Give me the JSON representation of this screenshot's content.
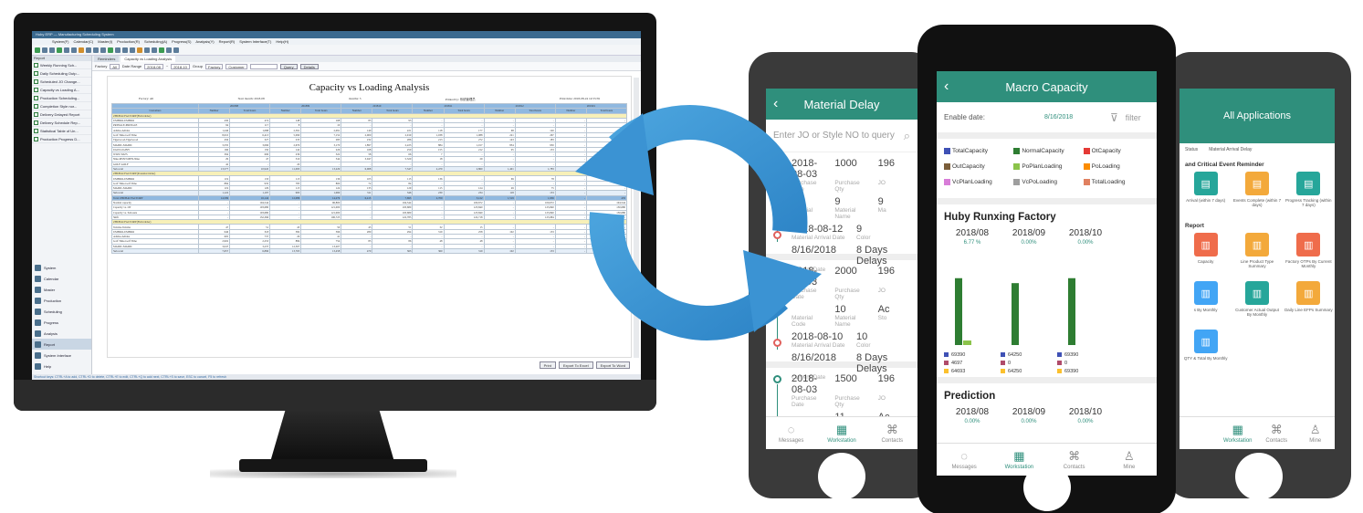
{
  "desktop": {
    "title_bar": "Huby ERP — Manufacturing Scheduling System",
    "menu": [
      "System(F)",
      "Calendar(C)",
      "Master(I)",
      "Production(R)",
      "Scheduling(A)",
      "Progress(S)",
      "Analysis(Y)",
      "Report(R)",
      "System Interface(T)",
      "Help(H)"
    ],
    "sidebar_header": "Report",
    "sidebar_reports": [
      "Weekly Running Sch...",
      "Daily Scheduling Outp...",
      "Scheduled JO Change...",
      "Capacity vs Loading A...",
      "Production Scheduling...",
      "Completion Style nor...",
      "Delivery Delayed Report",
      "Delivery Schedule Rep...",
      "Statistical Table of Un...",
      "Production Progress D..."
    ],
    "nav": [
      "System",
      "Calendar",
      "Master",
      "Production",
      "Scheduling",
      "Progress",
      "Analysis",
      "Report",
      "System Interface",
      "Help"
    ],
    "tabs": [
      "Reminders",
      "Capacity vs Loading Analysis"
    ],
    "filters": {
      "factory_label": "Factory",
      "factory_value": "All",
      "date_range_label": "Date Range",
      "date_from": "2018-08",
      "date_to": "2018-10",
      "group_label": "Group",
      "group_value": "Factory",
      "group2_value": "Customer",
      "query_btn": "Query",
      "details_btn": "Details"
    },
    "report": {
      "title": "Capacity vs Loading Analysis",
      "meta_factory": "Factory: All",
      "meta_start": "Start month: 2018-08",
      "meta_months": "months: 3",
      "meta_printed": "Printed by: 系统管理员",
      "meta_print_time": "Print time: 2018-08-24 14:55:59",
      "months": [
        "201808",
        "201809",
        "201810",
        "201811",
        "201812",
        "201901"
      ],
      "sub_headers": [
        "Number",
        "Total hours"
      ],
      "customers_label": "Customers",
      "rows": [
        {
          "type": "sect",
          "cells": [
            "ZHUHAI FACTORY(Firm Order)"
          ]
        },
        {
          "type": "row",
          "cells": [
            "UMBRO-UMBRO",
            "430",
            "474",
            "148",
            "168",
            "85",
            "93",
            "-",
            "-",
            "-",
            "-",
            "-",
            "-"
          ]
        },
        {
          "type": "row",
          "cells": [
            "PRINGLE-PRINGLE",
            "94",
            "117",
            "8",
            "10",
            "-",
            "-",
            "-",
            "-",
            "-",
            "-",
            "-",
            "-"
          ]
        },
        {
          "type": "row",
          "cells": [
            "Adidas-Adidas",
            "1,246",
            "1,088",
            "2,391",
            "2,091",
            "140",
            "221",
            "118",
            "177",
            "68",
            "120",
            "-",
            "-"
          ]
        },
        {
          "type": "row",
          "cells": [
            "Golf Time-Golf Time",
            "8,010",
            "6,413",
            "5,090",
            "7,152",
            "2,000",
            "2,919",
            "1,038",
            "1,088",
            "221",
            "267",
            "-",
            "-"
          ]
        },
        {
          "type": "row",
          "cells": [
            "Tigerwood-Tigerwood",
            "456",
            "327",
            "235",
            "283",
            "232",
            "286",
            "213",
            "272",
            "143",
            "183",
            "-",
            "-"
          ]
        },
        {
          "type": "row",
          "cells": [
            "MADIC-MADIC",
            "3,335",
            "3,066",
            "2,679",
            "3,170",
            "1,897",
            "2,223",
            "884",
            "1,017",
            "834",
            "950",
            "-",
            "-"
          ]
        },
        {
          "type": "row",
          "cells": [
            "UGIN-UGINY",
            "166",
            "150",
            "142",
            "226",
            "168",
            "250",
            "155",
            "212",
            "95",
            "133",
            "-",
            "-"
          ]
        },
        {
          "type": "row",
          "cells": [
            "WIZS-WIZS",
            "394",
            "606",
            "236",
            "322",
            "58",
            "66",
            "7",
            "-",
            "-",
            "-",
            "-",
            "-"
          ]
        },
        {
          "type": "row",
          "cells": [
            "Nike.MSNT.MEN-Nike",
            "29",
            "47",
            "310",
            "544",
            "3,047",
            "5,320",
            "18",
            "29",
            "-",
            "-",
            "-",
            "-"
          ]
        },
        {
          "type": "row",
          "cells": [
            "GOLF-GOLF",
            "42",
            "-",
            "20",
            "-",
            "-",
            "-",
            "-",
            "-",
            "-",
            "-",
            "-",
            "-"
          ]
        },
        {
          "type": "sub",
          "cells": [
            "Sub-total",
            "13,577",
            "10,945",
            "11,093",
            "13,229",
            "6,068",
            "7,347",
            "2,479",
            "2,860",
            "1,401",
            "1,783",
            "396",
            "435"
          ]
        },
        {
          "type": "sect",
          "cells": [
            "ZHUHAI FACTORY(Potential Order)"
          ]
        },
        {
          "type": "row",
          "cells": [
            "UMBRO-UMBRO",
            "119",
            "133",
            "113",
            "136",
            "105",
            "115",
            "136",
            "-",
            "69",
            "78",
            "-",
            "-"
          ]
        },
        {
          "type": "row",
          "cells": [
            "Golf Time-Golf Time",
            "884",
            "935",
            "785",
            "800",
            "72",
            "84",
            "-",
            "-",
            "-",
            "-",
            "-",
            "-"
          ]
        },
        {
          "type": "row",
          "cells": [
            "MADIC-MADIC",
            "119",
            "129",
            "115",
            "124",
            "135",
            "129",
            "115",
            "124",
            "49",
            "75",
            "-",
            "-"
          ]
        },
        {
          "type": "sub",
          "cells": [
            "Sub-total",
            "1,122",
            "1,197",
            "993",
            "1,060",
            "311",
            "346",
            "230",
            "234",
            "118",
            "153",
            "-",
            "-"
          ]
        },
        {
          "type": "total",
          "cells": [
            "Total ZHUHAI FACTORY",
            "14,599",
            "16,142",
            "12,086",
            "14,279",
            "6,413",
            "7,693",
            "2,709",
            "3,122",
            "1,519",
            "1,936",
            "-",
            "435"
          ]
        },
        {
          "type": "row",
          "cells": [
            "Normal capacity",
            "-",
            "104,544",
            "-",
            "96,800",
            "-",
            "104,544",
            "-",
            "100,672",
            "-",
            "100,672",
            "-",
            "104,544"
          ]
        },
        {
          "type": "row",
          "cells": [
            "Capacity vs. OT",
            "-",
            "103,680",
            "-",
            "121,000",
            "-",
            "103,680",
            "-",
            "125,840",
            "-",
            "125,840",
            "-",
            "130,680"
          ]
        },
        {
          "type": "row",
          "cells": [
            "Capacity vs. Sub-nets",
            "-",
            "103,680",
            "-",
            "121,000",
            "-",
            "103,680",
            "-",
            "125,840",
            "-",
            "125,840",
            "-",
            "130,680"
          ]
        },
        {
          "type": "row",
          "cells": [
            "Shift",
            "-",
            "132,366",
            "-",
            "106,723",
            "-",
            "122,785",
            "-",
            "122,718",
            "-",
            "125,984",
            "-",
            "-"
          ]
        },
        {
          "type": "sect",
          "cells": [
            "ZHUHAI FACTORY(Firm Order)"
          ]
        },
        {
          "type": "row",
          "cells": [
            "Teloma-Teloma",
            "47",
            "51",
            "45",
            "50",
            "45",
            "51",
            "32",
            "15",
            "-",
            "-",
            "-",
            "-"
          ]
        },
        {
          "type": "row",
          "cells": [
            "UMBRO-UMBRO",
            "646",
            "318",
            "382",
            "396",
            "280",
            "294",
            "319",
            "258",
            "102",
            "133",
            "-",
            "-"
          ]
        },
        {
          "type": "row",
          "cells": [
            "Adidas-Adidas",
            "605",
            "737",
            "29",
            "41",
            "-",
            "-",
            "-",
            "-",
            "-",
            "-",
            "-",
            "-"
          ]
        },
        {
          "type": "row",
          "cells": [
            "Golf Time-Golf Time",
            "2,902",
            "2,253",
            "884",
            "754",
            "85",
            "86",
            "48",
            "48",
            "-",
            "-",
            "-",
            "-"
          ]
        },
        {
          "type": "row",
          "cells": [
            "MADIC-MADIC",
            "3,047",
            "3,237",
            "12,307",
            "13,207",
            "-",
            "-",
            "-",
            "-",
            "-",
            "-",
            "-",
            "-"
          ]
        },
        {
          "type": "sub",
          "cells": [
            "Sub-total",
            "7,657",
            "6,896",
            "13,765",
            "13,458",
            "470",
            "363",
            "360",
            "319",
            "102",
            "133",
            "-",
            "-"
          ]
        }
      ],
      "buttons": [
        "Print",
        "Export To Excel",
        "Export To Word"
      ]
    },
    "status": "Shortcut keys: CTRL+A to add, CTRL+D to delete, CTRL+E to edit, CTRL+Q to add next, CTRL+S to save, ESC to cancel, F5 to refresh"
  },
  "material_delay": {
    "title": "Material Delay",
    "search_placeholder": "Enter JO or Style NO to query",
    "cards": [
      {
        "date": "2018-08-03",
        "date_lbl": "Purchase Date",
        "qty": "1000",
        "qty_lbl": "Purchase Qty",
        "extra": "196",
        "extra2": "JO",
        "code": "9",
        "code_lbl": "Material Name",
        "code_left_lbl": "Material Code",
        "mat_date": "2018-08-12",
        "mat_date_lbl": "Material Arrival Date",
        "color_val": "9",
        "color_lbl": "Color",
        "extra3": "9",
        "extra4": "Ma",
        "current": "8/16/2018",
        "current_lbl": "Current Date",
        "delay": "8 Days Delays"
      },
      {
        "date": "2018-08-03",
        "date_lbl": "Purchase Date",
        "qty": "2000",
        "qty_lbl": "Purchase Qty",
        "extra": "196",
        "extra2": "JO",
        "code": "10",
        "code_lbl": "Material Name",
        "code_left_lbl": "Material Code",
        "mat_date": "2018-08-10",
        "mat_date_lbl": "Material Arrival Date",
        "color_val": "10",
        "color_lbl": "Color",
        "extra3": "Ac",
        "extra4": "Sto",
        "current": "8/16/2018",
        "current_lbl": "Current Date",
        "delay": "8 Days Delays"
      },
      {
        "date": "2018-08-03",
        "date_lbl": "Purchase Date",
        "qty": "1500",
        "qty_lbl": "Purchase Qty",
        "extra": "196",
        "extra2": "JO",
        "code": "11",
        "code_lbl": "Material Code",
        "code_left_lbl": "Material Code",
        "mat_date": "",
        "mat_date_lbl": "",
        "color_val": "10",
        "color_lbl": "Material Name",
        "extra3": "Ac",
        "extra4": "",
        "current": "",
        "current_lbl": "",
        "delay": ""
      }
    ],
    "tabbar": [
      "Messages",
      "Workstation",
      "Contacts"
    ]
  },
  "macro": {
    "title": "Macro Capacity",
    "enable_label": "Enable date:",
    "enable_value": "8/16/2018",
    "filter_label": "filter",
    "legend": [
      {
        "name": "TotalCapacity",
        "color": "#3f51b5"
      },
      {
        "name": "NormalCapacity",
        "color": "#2e7d32"
      },
      {
        "name": "OtCapacity",
        "color": "#e53935"
      },
      {
        "name": "OutCapacity",
        "color": "#7b5e3a"
      },
      {
        "name": "PoPlanLoading",
        "color": "#8bc34a"
      },
      {
        "name": "PoLoading",
        "color": "#fb8c00"
      },
      {
        "name": "VcPlanLoading",
        "color": "#d87dd8"
      },
      {
        "name": "VcPoLoading",
        "color": "#9e9e9e"
      },
      {
        "name": "TotalLoading",
        "color": "#e08060"
      }
    ],
    "factory": "Huby Runxing Factory",
    "periods": [
      "2018/08",
      "2018/09",
      "2018/10"
    ],
    "percents": [
      "6.77 %",
      "0.00%",
      "0.00%"
    ],
    "chart_data": {
      "type": "bar",
      "categories": [
        "2018/08",
        "2018/09",
        "2018/10"
      ],
      "series": [
        {
          "name": "",
          "values": [
            69390,
            64250,
            69390
          ]
        },
        {
          "name": "",
          "values": [
            4697,
            0,
            0
          ]
        }
      ]
    },
    "value_rows": [
      [
        {
          "c": "#3f51b5",
          "v": "69390"
        },
        {
          "c": "#b04b6a",
          "v": "4697"
        },
        {
          "c": "#fbc02d",
          "v": "64693"
        }
      ],
      [
        {
          "c": "#3f51b5",
          "v": "64250"
        },
        {
          "c": "#b04b6a",
          "v": "0"
        },
        {
          "c": "#fbc02d",
          "v": "64250"
        }
      ],
      [
        {
          "c": "#3f51b5",
          "v": "69390"
        },
        {
          "c": "#b04b6a",
          "v": "0"
        },
        {
          "c": "#fbc02d",
          "v": "69390"
        }
      ]
    ],
    "prediction_title": "Prediction",
    "prediction_periods": [
      "2018/08",
      "2018/09",
      "2018/10"
    ],
    "prediction_percents": [
      "0.00%",
      "0.00%",
      "0.00%"
    ],
    "tabbar": [
      "Messages",
      "Workstation",
      "Contacts",
      "Mine"
    ]
  },
  "apps": {
    "title": "All Applications",
    "sub_links": [
      "Status",
      "Material Arrival Delay"
    ],
    "critical_title": "and Critical Event Reminder",
    "critical_tiles": [
      {
        "label": "Arrival (within 7 days)",
        "color": "#26a69a"
      },
      {
        "label": "Events Complete (within 7 days)",
        "color": "#f3a93b"
      },
      {
        "label": "Progress Tracking (within 7 days)",
        "color": "#26a69a"
      }
    ],
    "report_title": "Report",
    "report_tiles": [
      {
        "label": "Capacity",
        "color": "#ef6c4b"
      },
      {
        "label": "Line Product Type Summary",
        "color": "#f3a93b"
      },
      {
        "label": "Factory OTPs By Current Monthly",
        "color": "#ef6c4b"
      },
      {
        "label": "s By Monthly",
        "color": "#42a5f5"
      },
      {
        "label": "Customer Actual Output By Monthly",
        "color": "#26a69a"
      },
      {
        "label": "Daily Line EFPs Summary",
        "color": "#f3a93b"
      },
      {
        "label": "QTY & Total By Monthly",
        "color": "#42a5f5"
      }
    ],
    "tabbar": [
      "",
      "Workstation",
      "Contacts",
      "Mine"
    ]
  }
}
